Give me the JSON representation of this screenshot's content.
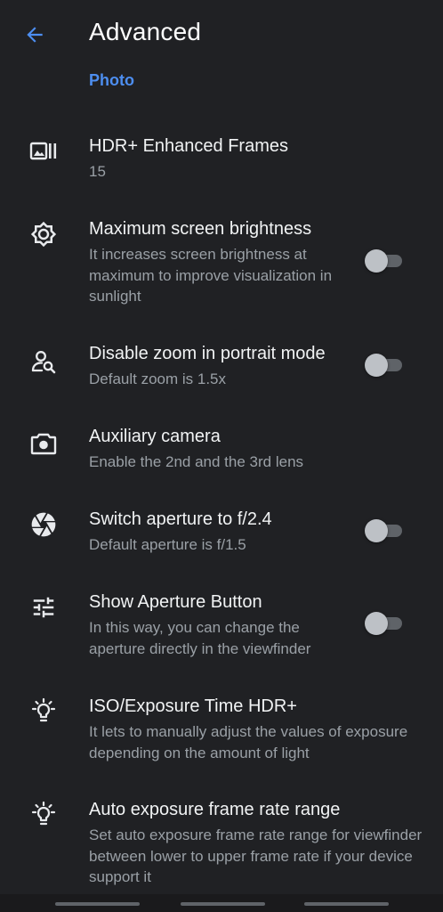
{
  "header": {
    "title": "Advanced"
  },
  "section": {
    "label": "Photo"
  },
  "colors": {
    "accent": "#4d8ef0",
    "background": "#202124",
    "title_text": "#f1f3f4",
    "summary_text": "#9aa0a6",
    "toggle_off_track": "#5f6368",
    "toggle_off_thumb": "#bdc1c6"
  },
  "settings": [
    {
      "icon": "hdr-frames-icon",
      "title": "HDR+ Enhanced Frames",
      "summary": "15"
    },
    {
      "icon": "brightness-icon",
      "title": "Maximum screen brightness",
      "summary": "It increases screen brightness at maximum to improve visualization in sunlight",
      "toggle": false
    },
    {
      "icon": "portrait-zoom-icon",
      "title": "Disable zoom in portrait mode",
      "summary": "Default zoom is 1.5x",
      "toggle": false
    },
    {
      "icon": "camera-icon",
      "title": "Auxiliary camera",
      "summary": "Enable the 2nd and the 3rd lens"
    },
    {
      "icon": "aperture-icon",
      "title": "Switch aperture to f/2.4",
      "summary": "Default aperture is f/1.5",
      "toggle": false
    },
    {
      "icon": "tune-icon",
      "title": "Show Aperture Button",
      "summary": "In this way, you can change the aperture directly in the viewfinder",
      "toggle": false
    },
    {
      "icon": "lightbulb-icon",
      "title": "ISO/Exposure Time HDR+",
      "summary": "It lets to manually adjust the values of exposure depending on the amount of light"
    },
    {
      "icon": "lightbulb-icon",
      "title": "Auto exposure frame rate range",
      "summary": "Set auto exposure frame rate range for viewfinder between lower to upper frame rate if your device support it"
    }
  ]
}
